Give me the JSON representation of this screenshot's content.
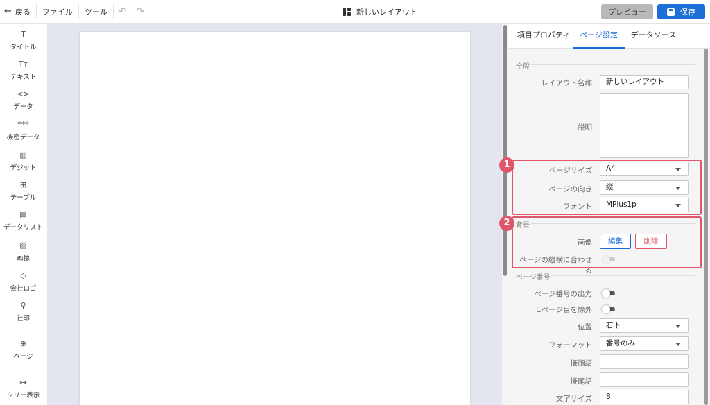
{
  "topbar": {
    "back_label": "戻る",
    "menu_file": "ファイル",
    "menu_tools": "ツール",
    "title": "新しいレイアウト",
    "preview_label": "プレビュー",
    "save_label": "保存"
  },
  "sidebar": {
    "items": [
      {
        "icon": "T",
        "label": "タイトル"
      },
      {
        "icon": "Tт",
        "label": "テキスト"
      },
      {
        "icon": "<>",
        "label": "データ"
      },
      {
        "icon": "***",
        "label": "機密データ"
      },
      {
        "icon": "▥",
        "label": "デジット"
      },
      {
        "icon": "⊞",
        "label": "テーブル"
      },
      {
        "icon": "▤",
        "label": "データリスト"
      },
      {
        "icon": "▨",
        "label": "画像"
      },
      {
        "icon": "◇",
        "label": "会社ロゴ"
      },
      {
        "icon": "⚲",
        "label": "社印"
      },
      {
        "icon": "⊕",
        "label": "ページ"
      },
      {
        "icon": "⊶",
        "label": "ツリー表示"
      }
    ]
  },
  "tabs": {
    "item_props": "項目プロパティ",
    "page_settings": "ページ設定",
    "data_source": "データソース"
  },
  "general": {
    "section": "全般",
    "layout_name_label": "レイアウト名称",
    "layout_name_value": "新しいレイアウト",
    "description_label": "説明",
    "page_size_label": "ページサイズ",
    "page_size_value": "A4",
    "orientation_label": "ページの向き",
    "orientation_value": "縦",
    "font_label": "フォント",
    "font_value": "MPlus1p"
  },
  "background": {
    "section": "背景",
    "image_label": "画像",
    "edit_label": "編集",
    "delete_label": "削除",
    "fit_label": "ページの縦横に合わせる"
  },
  "page_number": {
    "section": "ページ番号",
    "output_label": "ページ番号の出力",
    "exclude_first_label": "1ページ目を除外",
    "position_label": "位置",
    "position_value": "右下",
    "format_label": "フォーマット",
    "format_value": "番号のみ",
    "prefix_label": "接頭語",
    "suffix_label": "接尾語",
    "font_size_label": "文字サイズ",
    "font_size_value": "8"
  },
  "annotations": {
    "badge1": "1",
    "badge2": "2",
    "accent_color": "#e0566a"
  },
  "colors": {
    "primary": "#1c6fd6",
    "danger": "#e0566a",
    "canvas_bg": "#e3e6ee",
    "panel_bg": "#f5f5f5"
  }
}
